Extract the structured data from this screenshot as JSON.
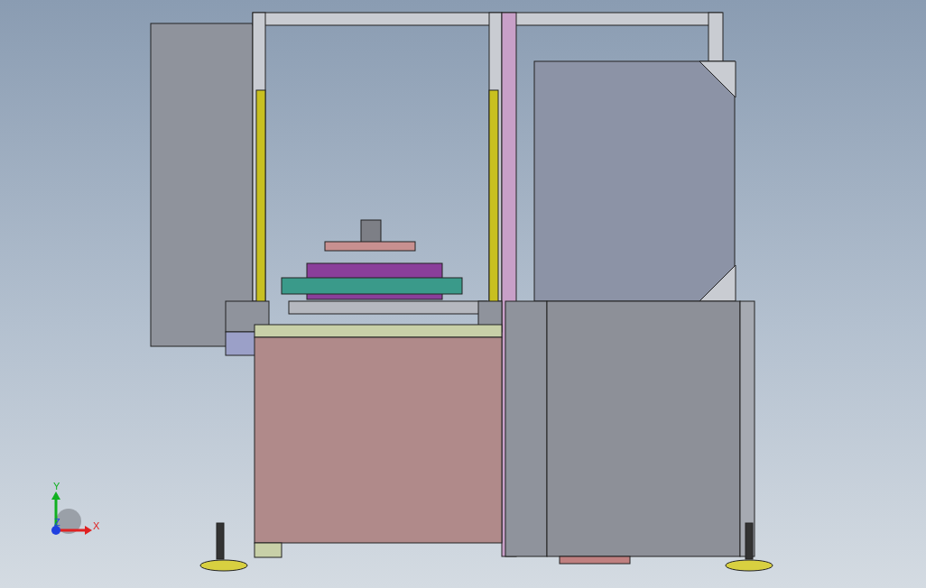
{
  "viewport": {
    "triad": {
      "y_label": "Y",
      "z_label": "Z",
      "x_label": "X"
    }
  }
}
